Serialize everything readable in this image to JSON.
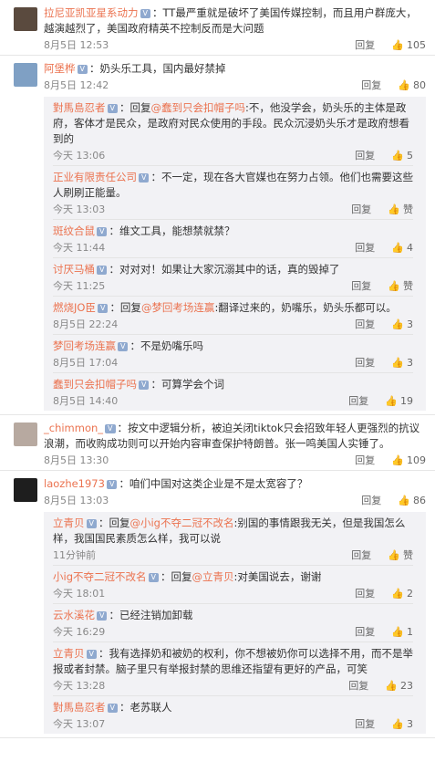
{
  "comments": [
    {
      "user": "拉尼亚凯亚星系动力",
      "text": "：TT最严重就是破坏了美国传媒控制，而且用户群庞大，越演越烈了，美国政府精英不控制反而是大问题",
      "time": "8月5日 12:53",
      "reply": "回复",
      "likes": "105",
      "avatar_color": "#5a4a3e"
    },
    {
      "user": "阿堡桦",
      "text": "：奶头乐工具，国内最好禁掉",
      "time": "8月5日 12:42",
      "reply": "回复",
      "likes": "80",
      "avatar_color": "#7fa0c4",
      "replies": [
        {
          "user": "對馬島忍者",
          "reply_prefix": "：回复",
          "reply_target": "@蠢到只会扣帽子吗",
          "text": ":不，他没学会，奶头乐的主体是政府，客体才是民众，是政府对民众使用的手段。民众沉浸奶头乐才是政府想看到的",
          "time": "今天 13:06",
          "reply": "回复",
          "likes": "5"
        },
        {
          "user": "正业有限责任公司",
          "text": "：不一定，现在各大官媒也在努力占领。他们也需要这些人刷刷正能量。",
          "time": "今天 13:03",
          "reply": "回复",
          "likes": "赞"
        },
        {
          "user": "斑纹合鼠",
          "text": "：维文工具，能想禁就禁？",
          "time": "今天 11:44",
          "reply": "回复",
          "likes": "4"
        },
        {
          "user": "讨厌马桶",
          "text": "：对对对！如果让大家沉溺其中的话，真的毁掉了",
          "time": "今天 11:25",
          "reply": "回复",
          "likes": "赞"
        },
        {
          "user": "燃烧JO臣",
          "reply_prefix": "：回复",
          "reply_target": "@梦回考场连赢",
          "text": ":翻译过来的，奶嘴乐，奶头乐都可以。",
          "time": "8月5日 22:24",
          "reply": "回复",
          "likes": "3"
        },
        {
          "user": "梦回考场连赢",
          "text": "：不是奶嘴乐吗",
          "time": "8月5日 17:04",
          "reply": "回复",
          "likes": "3"
        },
        {
          "user": "蠢到只会扣帽子吗",
          "text": "：可算学会个词",
          "time": "8月5日 14:40",
          "reply": "回复",
          "likes": "19"
        }
      ]
    },
    {
      "user": "_chimmon_",
      "text": "：按文中逻辑分析，被迫关闭tiktok只会招致年轻人更强烈的抗议浪潮，而收购成功则可以开始内容审查保护特朗普。张一鸣美国人实锤了。",
      "time": "8月5日 13:30",
      "reply": "回复",
      "likes": "109",
      "avatar_color": "#b7a9a0"
    },
    {
      "user": "laozhe1973",
      "text": "：咱们中国对这类企业是不是太宽容了？",
      "time": "8月5日 13:03",
      "reply": "回复",
      "likes": "86",
      "avatar_color": "#1e1e1e",
      "replies": [
        {
          "user": "立青贝",
          "reply_prefix": "：回复",
          "reply_target": "@小ig不夺二冠不改名",
          "text": ":别国的事情跟我无关，但是我国怎么样，我国国民素质怎么样，我可以说",
          "time": "11分钟前",
          "reply": "回复",
          "likes": "赞"
        },
        {
          "user": "小ig不夺二冠不改名",
          "reply_prefix": "：回复",
          "reply_target": "@立青贝",
          "text": ":对美国说去，谢谢",
          "time": "今天 18:01",
          "reply": "回复",
          "likes": "2"
        },
        {
          "user": "云水溪花",
          "text": "：已经注销加卸载",
          "time": "今天 16:29",
          "reply": "回复",
          "likes": "1"
        },
        {
          "user": "立青贝",
          "text": "：我有选择奶和被奶的权利，你不想被奶你可以选择不用，而不是举报或者封禁。脑子里只有举报封禁的思维还指望有更好的产品，可笑",
          "time": "今天 13:28",
          "reply": "回复",
          "likes": "23"
        },
        {
          "user": "對馬島忍者",
          "text": "：老苏联人",
          "time": "今天 13:07",
          "reply": "回复",
          "likes": "3"
        }
      ]
    }
  ],
  "colors": {
    "username": "#eb7350",
    "background": "#ffffff",
    "reply_bg": "#f2f2f5"
  },
  "icons": {
    "like": "thumbs-up-icon",
    "badge": "vip-badge-icon",
    "emoji": "smiley-emoji-icon"
  }
}
